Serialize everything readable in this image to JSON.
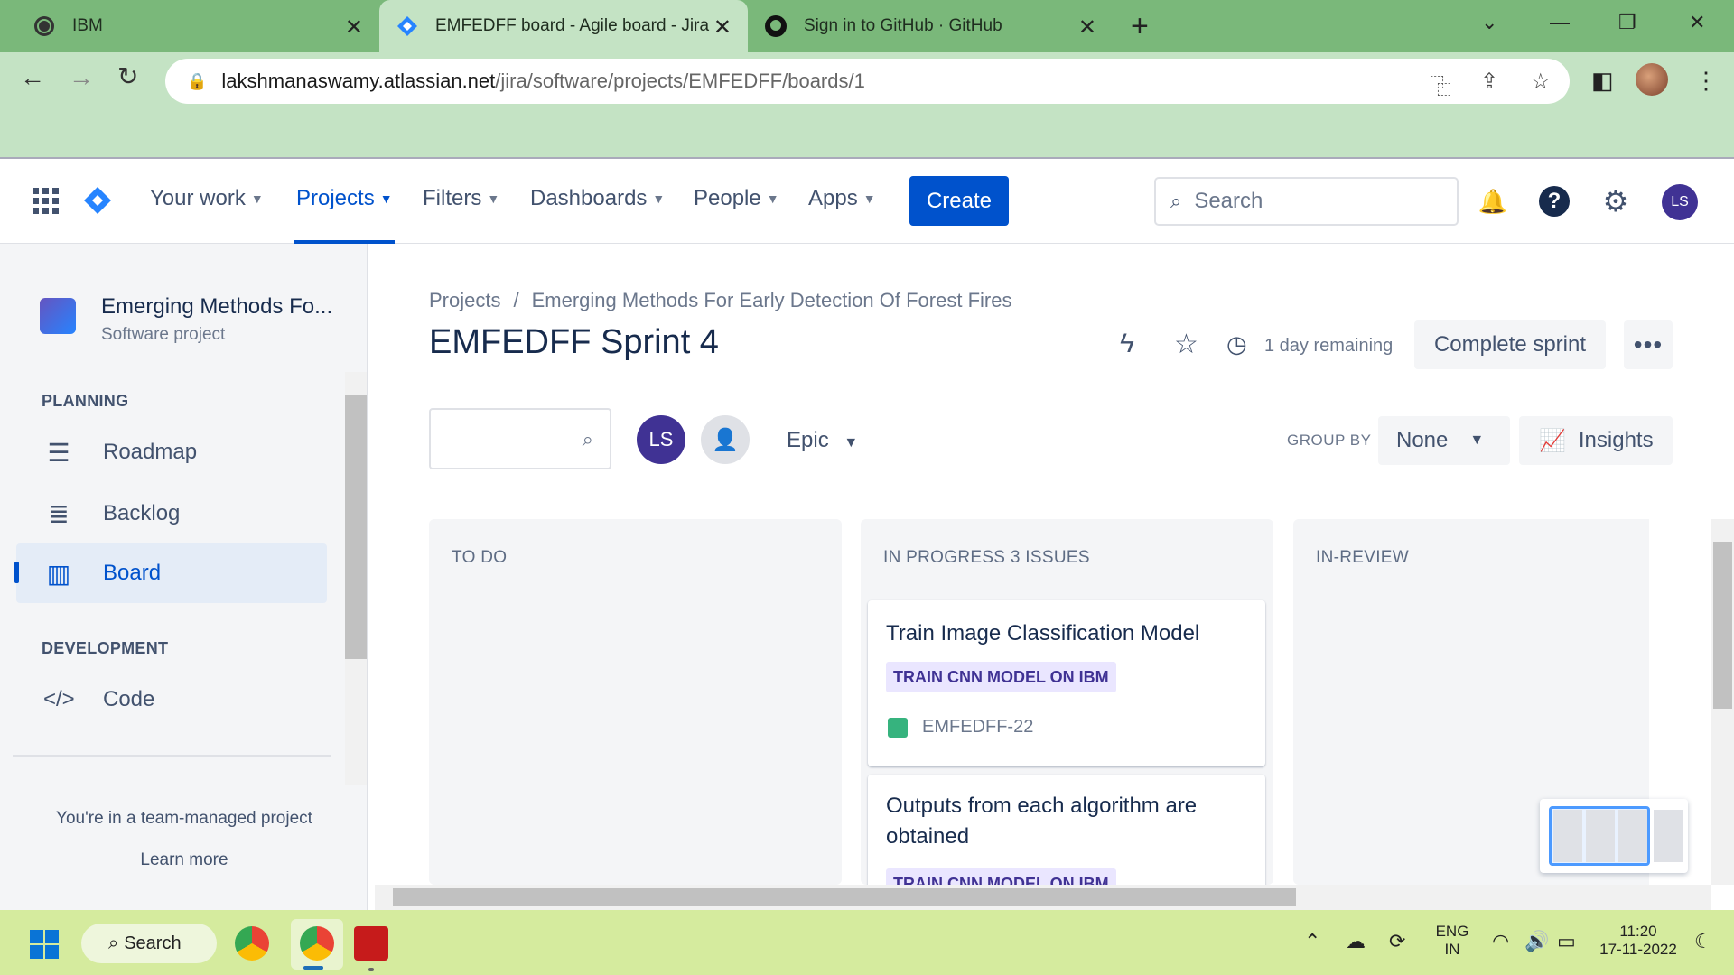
{
  "browser": {
    "tabs": [
      {
        "title": "IBM"
      },
      {
        "title": "EMFEDFF board - Agile board - Jira"
      },
      {
        "title": "Sign in to GitHub · GitHub"
      }
    ],
    "url_host": "lakshmanaswamy.atlassian.net",
    "url_path": "/jira/software/projects/EMFEDFF/boards/1"
  },
  "jira_nav": {
    "your_work": "Your work",
    "projects": "Projects",
    "filters": "Filters",
    "dashboards": "Dashboards",
    "people": "People",
    "apps": "Apps",
    "create": "Create",
    "search_placeholder": "Search",
    "user_initials": "LS"
  },
  "sidebar": {
    "project_name": "Emerging Methods Fo...",
    "project_type": "Software project",
    "planning_header": "PLANNING",
    "items": [
      {
        "label": "Roadmap"
      },
      {
        "label": "Backlog"
      },
      {
        "label": "Board"
      }
    ],
    "development_header": "DEVELOPMENT",
    "code_label": "Code",
    "team_note": "You're in a team-managed project",
    "learn_more": "Learn more"
  },
  "main": {
    "breadcrumb_root": "Projects",
    "breadcrumb_project": "Emerging Methods For Early Detection Of Forest Fires",
    "sprint_title": "EMFEDFF Sprint 4",
    "remaining": "1 day remaining",
    "complete_sprint": "Complete sprint",
    "avatar_initials": "LS",
    "epic_filter": "Epic",
    "group_by_label": "GROUP BY",
    "group_by_value": "None",
    "insights": "Insights"
  },
  "columns": [
    {
      "title": "TO DO"
    },
    {
      "title": "IN PROGRESS 3 ISSUES"
    },
    {
      "title": "IN-REVIEW"
    }
  ],
  "cards": [
    {
      "title": "Train Image Classification Model",
      "epic": "TRAIN CNN MODEL ON IBM",
      "key": "EMFEDFF-22"
    },
    {
      "title": "Outputs from each algorithm are obtained",
      "epic": "TRAIN CNN MODEL ON IBM"
    }
  ],
  "taskbar": {
    "search": "Search",
    "lang_line1": "ENG",
    "lang_line2": "IN",
    "time": "11:20",
    "date": "17-11-2022"
  },
  "colors": {
    "jira_blue": "#0052cc",
    "epic_purple_bg": "#eae6ff",
    "epic_purple_text": "#403294",
    "story_green": "#36b37e",
    "browser_frame": "#7ab87a"
  }
}
